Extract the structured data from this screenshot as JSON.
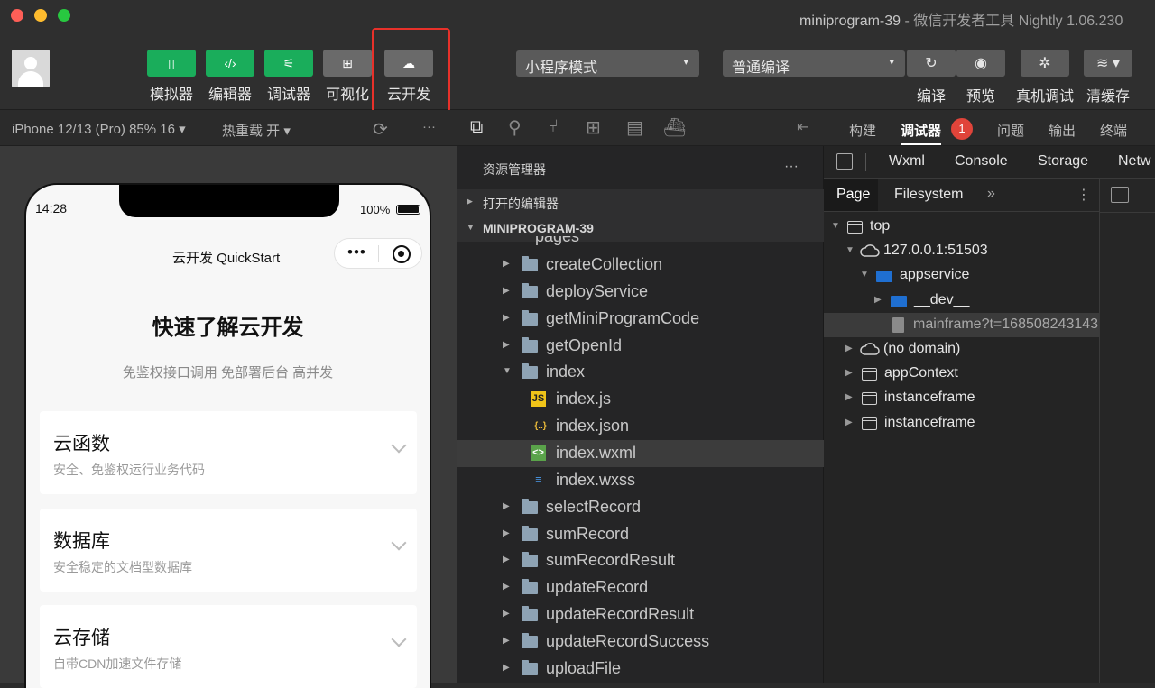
{
  "window": {
    "title_main": "miniprogram-39",
    "title_rest": " - 微信开发者工具 Nightly 1.06.230"
  },
  "toolbar": {
    "tools": [
      {
        "label": "模拟器",
        "icon": "phone-icon",
        "glyph": "▯",
        "style": "green"
      },
      {
        "label": "编辑器",
        "icon": "code-icon",
        "glyph": "‹/›",
        "style": "green"
      },
      {
        "label": "调试器",
        "icon": "debug-sliders-icon",
        "glyph": "⚟",
        "style": "green"
      },
      {
        "label": "可视化",
        "icon": "layout-icon",
        "glyph": "⊞",
        "style": "gray"
      },
      {
        "label": "云开发",
        "icon": "cloud-icon",
        "glyph": "☁",
        "style": "gray"
      }
    ],
    "mode_select": "小程序模式",
    "compile_select": "普通编译",
    "right_tools": [
      {
        "label": "编译",
        "icon": "refresh-icon",
        "glyph": "↻"
      },
      {
        "label": "预览",
        "icon": "eye-icon",
        "glyph": "◉"
      },
      {
        "label": "真机调试",
        "icon": "bug-icon",
        "glyph": "✲"
      },
      {
        "label": "清缓存",
        "icon": "layers-icon",
        "glyph": "≋ ▾"
      }
    ]
  },
  "simulator": {
    "device": "iPhone 12/13 (Pro) 85% 16 ▾",
    "hot_reload": "热重载 开 ▾",
    "more": "···",
    "status_time": "14:28",
    "battery": "100%",
    "nav_title": "云开发 QuickStart",
    "capsule_more": "•••",
    "heading": "快速了解云开发",
    "subheading": "免鉴权接口调用 免部署后台 高并发",
    "cards": [
      {
        "title": "云函数",
        "desc": "安全、免鉴权运行业务代码"
      },
      {
        "title": "数据库",
        "desc": "安全稳定的文档型数据库"
      },
      {
        "title": "云存储",
        "desc": "自带CDN加速文件存储"
      }
    ]
  },
  "explorer": {
    "title": "资源管理器",
    "more": "···",
    "open_editors": "打开的编辑器",
    "project": "MINIPROGRAM-39",
    "partial_folder": "pages",
    "items": [
      {
        "name": "createCollection",
        "type": "folder"
      },
      {
        "name": "deployService",
        "type": "folder"
      },
      {
        "name": "getMiniProgramCode",
        "type": "folder"
      },
      {
        "name": "getOpenId",
        "type": "folder"
      },
      {
        "name": "index",
        "type": "folder-open"
      },
      {
        "name": "index.js",
        "type": "js"
      },
      {
        "name": "index.json",
        "type": "json"
      },
      {
        "name": "index.wxml",
        "type": "wxml",
        "selected": true
      },
      {
        "name": "index.wxss",
        "type": "wxss"
      },
      {
        "name": "selectRecord",
        "type": "folder"
      },
      {
        "name": "sumRecord",
        "type": "folder"
      },
      {
        "name": "sumRecordResult",
        "type": "folder"
      },
      {
        "name": "updateRecord",
        "type": "folder"
      },
      {
        "name": "updateRecordResult",
        "type": "folder"
      },
      {
        "name": "updateRecordSuccess",
        "type": "folder"
      },
      {
        "name": "uploadFile",
        "type": "folder"
      }
    ]
  },
  "devtools": {
    "tabs": [
      "构建",
      "调试器",
      "问题",
      "输出",
      "终端"
    ],
    "badge": "1",
    "panels": [
      "Wxml",
      "Console",
      "Storage",
      "Netw"
    ],
    "subtabs": [
      "Page",
      "Filesystem",
      "»"
    ],
    "tree": [
      {
        "label": "top",
        "icon": "window"
      },
      {
        "label": "127.0.0.1:51503",
        "icon": "cloud"
      },
      {
        "label": "appservice",
        "icon": "folder"
      },
      {
        "label": "__dev__",
        "icon": "folder"
      },
      {
        "label": "mainframe?t=168508243143",
        "icon": "file",
        "selected": true
      },
      {
        "label": "(no domain)",
        "icon": "cloud"
      },
      {
        "label": "appContext",
        "icon": "window"
      },
      {
        "label": "instanceframe",
        "icon": "window"
      },
      {
        "label": "instanceframe",
        "icon": "window"
      }
    ]
  },
  "colors": {
    "accent_green": "#1aad5b",
    "highlight_red": "#e8312a",
    "badge_red": "#e0443a",
    "folder_blue": "#1f6fd1"
  }
}
